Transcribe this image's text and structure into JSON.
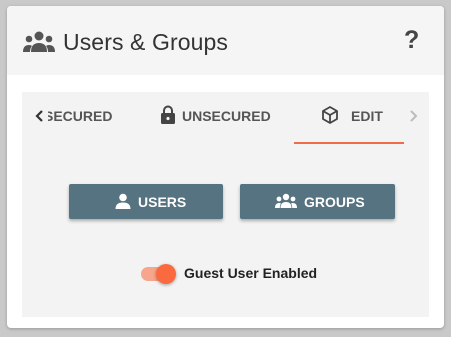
{
  "header": {
    "title": "Users & Groups",
    "icon": "groups-icon",
    "help_label": "?"
  },
  "tabs": [
    {
      "id": "secured",
      "label": "SECURED",
      "icon": "lock-closed-icon",
      "active": false
    },
    {
      "id": "unsecured",
      "label": "UNSECURED",
      "icon": "lock-icon",
      "active": false
    },
    {
      "id": "edit",
      "label": "EDIT",
      "icon": "cube-icon",
      "active": true
    }
  ],
  "buttons": {
    "users_label": "USERS",
    "groups_label": "GROUPS"
  },
  "guest_toggle": {
    "label": "Guest User Enabled",
    "enabled": true
  },
  "colors": {
    "accent": "#ef6c4a",
    "button_bg": "#557380",
    "toggle_track": "#f7a58c",
    "toggle_knob": "#fb6a3f",
    "header_bg": "#f5f5f5",
    "panel_bg": "#f3f3f3"
  }
}
